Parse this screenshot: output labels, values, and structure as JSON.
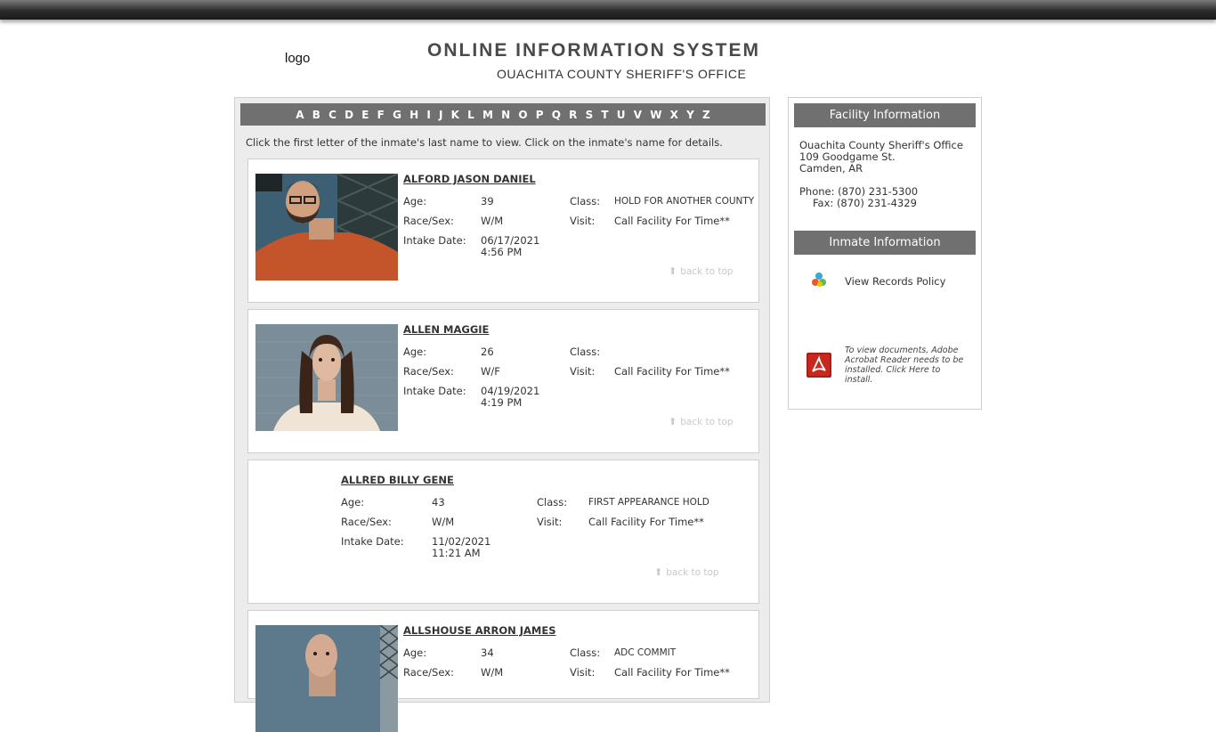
{
  "header": {
    "logo_alt": "logo",
    "title": "ONLINE INFORMATION SYSTEM",
    "subtitle": "OUACHITA COUNTY SHERIFF'S OFFICE"
  },
  "alphabet": [
    "A",
    "B",
    "C",
    "D",
    "E",
    "F",
    "G",
    "H",
    "I",
    "J",
    "K",
    "L",
    "M",
    "N",
    "O",
    "P",
    "Q",
    "R",
    "S",
    "T",
    "U",
    "V",
    "W",
    "X",
    "Y",
    "Z"
  ],
  "instructions": "Click the first letter of the inmate's last name to view.  Click on the inmate's name for details.",
  "labels": {
    "age": "Age:",
    "race_sex": "Race/Sex:",
    "intake_date": "Intake Date:",
    "class": "Class:",
    "visit": "Visit:",
    "back_to_top": "back to top"
  },
  "inmates": [
    {
      "name": "ALFORD JASON DANIEL",
      "age": "39",
      "race_sex": "W/M",
      "intake_date": "06/17/2021",
      "intake_time": "4:56 PM",
      "class": "HOLD FOR ANOTHER COUNTY",
      "visit": "Call Facility For Time**",
      "has_photo": true
    },
    {
      "name": "ALLEN MAGGIE",
      "age": "26",
      "race_sex": "W/F",
      "intake_date": "04/19/2021",
      "intake_time": "4:19 PM",
      "class": "",
      "visit": "Call Facility For Time**",
      "has_photo": true
    },
    {
      "name": "ALLRED BILLY GENE",
      "age": "43",
      "race_sex": "W/M",
      "intake_date": "11/02/2021",
      "intake_time": "11:21 AM",
      "class": "FIRST APPEARANCE HOLD",
      "visit": "Call Facility For Time**",
      "has_photo": false
    },
    {
      "name": "ALLSHOUSE ARRON JAMES",
      "age": "34",
      "race_sex": "W/M",
      "intake_date": "",
      "intake_time": "",
      "class": "ADC COMMIT",
      "visit": "Call Facility For Time**",
      "has_photo": true
    }
  ],
  "sidebar": {
    "facility_heading": "Facility Information",
    "address_line1": "Ouachita County Sheriff's Office",
    "address_line2": "109 Goodgame St.",
    "address_line3": "Camden, AR",
    "phone": "Phone: (870) 231-5300",
    "fax": "Fax: (870) 231-4329",
    "inmate_heading": "Inmate Information",
    "policy_link": "View Records Policy",
    "policy_icon": "records-policy-icon",
    "acrobat_icon": "adobe-acrobat-icon",
    "acrobat_note": "To view documents, Adobe Acrobat Reader needs to be installed. Click Here to install."
  },
  "colors": {
    "bar_gray": "#707070",
    "panel_bg": "#ececec",
    "acrobat_red": "#c8281e"
  }
}
